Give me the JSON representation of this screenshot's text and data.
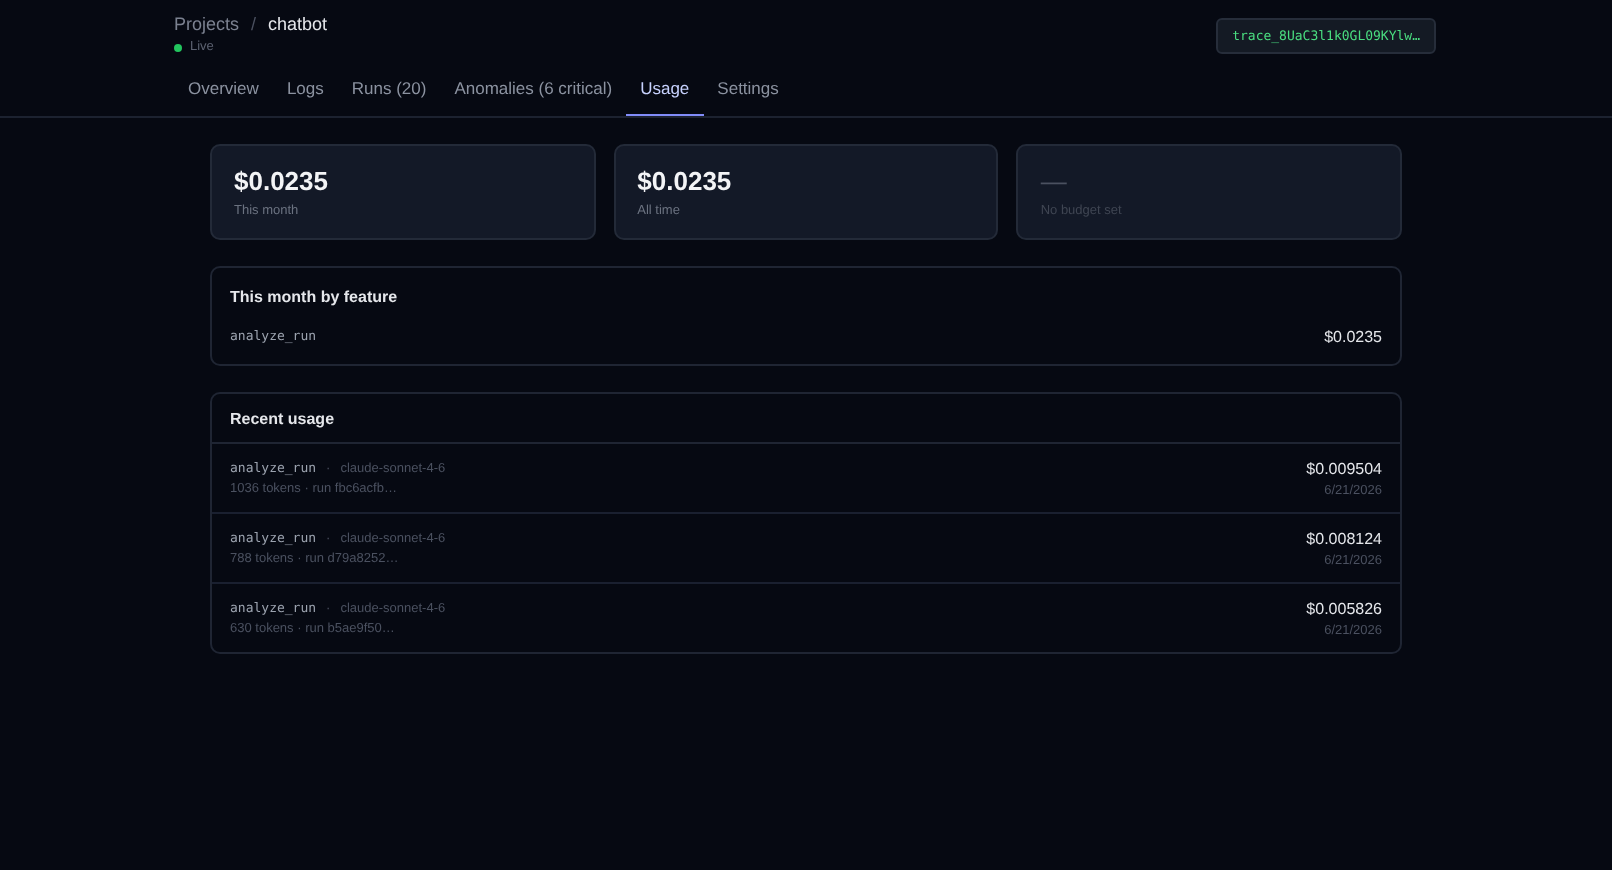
{
  "breadcrumb": {
    "parent": "Projects",
    "separator": "/",
    "current": "chatbot"
  },
  "status": {
    "label": "Live",
    "color": "#22c55e"
  },
  "trace_id": "trace_8UaC3l1k0GL09KYlw…",
  "tabs": [
    {
      "label": "Overview",
      "selected": false
    },
    {
      "label": "Logs",
      "selected": false
    },
    {
      "label": "Runs (20)",
      "selected": false
    },
    {
      "label": "Anomalies (6 critical)",
      "selected": false
    },
    {
      "label": "Usage",
      "selected": true
    },
    {
      "label": "Settings",
      "selected": false
    }
  ],
  "stats": [
    {
      "value": "$0.0235",
      "label": "This month",
      "muted": false
    },
    {
      "value": "$0.0235",
      "label": "All time",
      "muted": false
    },
    {
      "value": "—",
      "label": "No budget set",
      "muted": true
    }
  ],
  "by_feature": {
    "title": "This month by feature",
    "rows": [
      {
        "feature": "analyze_run",
        "cost": "$0.0235"
      }
    ]
  },
  "recent": {
    "title": "Recent usage",
    "rows": [
      {
        "feature": "analyze_run",
        "separator": "·",
        "model": "claude-sonnet-4-6",
        "details": "1036 tokens · run fbc6acfb…",
        "cost": "$0.009504",
        "date": "6/21/2026"
      },
      {
        "feature": "analyze_run",
        "separator": "·",
        "model": "claude-sonnet-4-6",
        "details": "788 tokens · run d79a8252…",
        "cost": "$0.008124",
        "date": "6/21/2026"
      },
      {
        "feature": "analyze_run",
        "separator": "·",
        "model": "claude-sonnet-4-6",
        "details": "630 tokens · run b5ae9f50…",
        "cost": "$0.005826",
        "date": "6/21/2026"
      }
    ]
  }
}
